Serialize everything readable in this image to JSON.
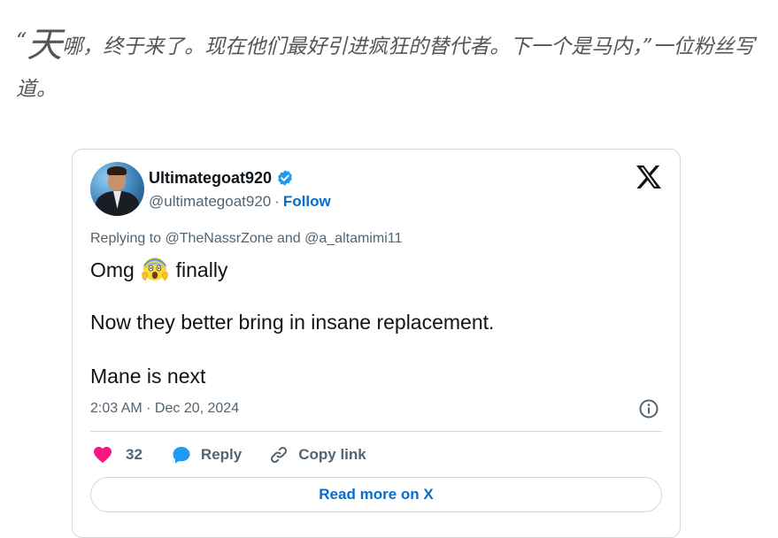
{
  "article": {
    "quote_dropcap": "天",
    "quote_rest": "哪，终于来了。现在他们最好引进疯狂的替代者。下一个是马内，”一位粉丝写道。"
  },
  "tweet": {
    "display_name": "Ultimategoat920",
    "handle": "@ultimategoat920",
    "separator": "·",
    "follow_label": "Follow",
    "replying_to": "Replying to @TheNassrZone and @a_altamimi11",
    "line1_before": "Omg",
    "line1_after": "finally",
    "line2": "Now they better bring in insane replacement.",
    "line3": "Mane is next",
    "timestamp": "2:03 AM · Dec 20, 2024",
    "like_count": "32",
    "reply_label": "Reply",
    "copy_link_label": "Copy link",
    "read_more_label": "Read more on X"
  },
  "colors": {
    "link_blue": "#006fd6",
    "verified_blue": "#1d9bf0",
    "like_pink": "#f91880",
    "muted_text": "#536471",
    "border": "#cfd9de"
  },
  "icons": [
    "verified-badge-icon",
    "x-logo-icon",
    "screaming-face-emoji",
    "info-icon",
    "heart-icon",
    "reply-bubble-icon",
    "link-icon"
  ]
}
